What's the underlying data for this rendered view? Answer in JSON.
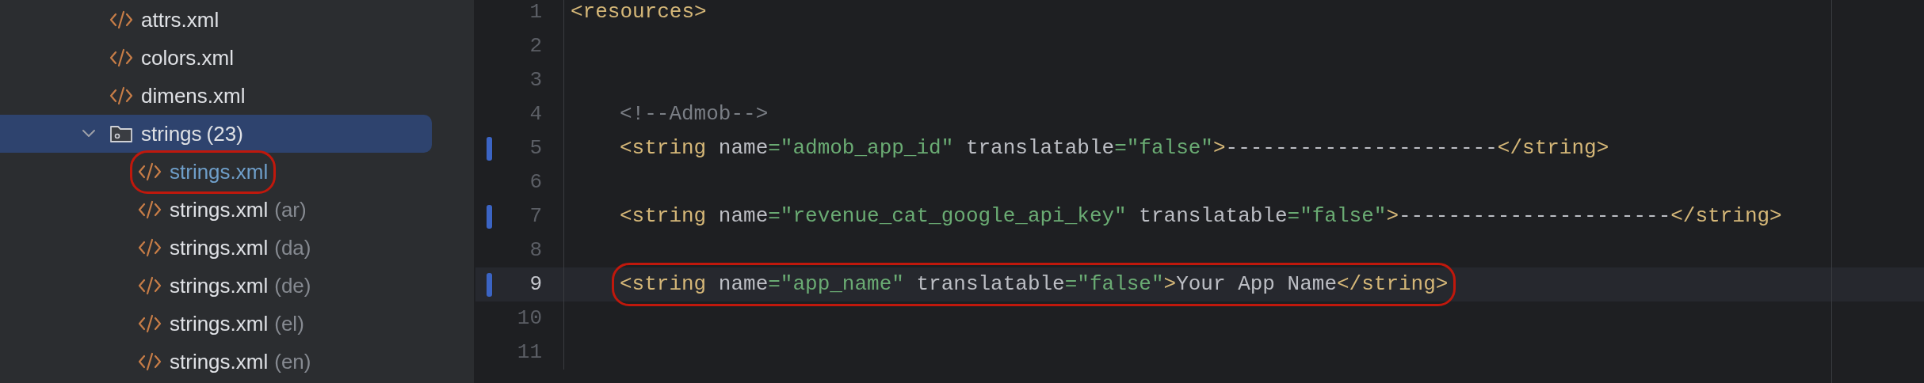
{
  "project_tree": {
    "items": [
      {
        "kind": "file",
        "name": "attrs.xml",
        "selected": false
      },
      {
        "kind": "file",
        "name": "colors.xml",
        "selected": false
      },
      {
        "kind": "file",
        "name": "dimens.xml",
        "selected": false
      },
      {
        "kind": "folder",
        "name": "strings",
        "count": "(23)",
        "expanded": true,
        "selected": true,
        "children": [
          {
            "kind": "file",
            "name": "strings.xml",
            "open": true,
            "circled": true
          },
          {
            "kind": "file",
            "name": "strings.xml",
            "qualifier": "(ar)",
            "open": false,
            "circled": false
          },
          {
            "kind": "file",
            "name": "strings.xml",
            "qualifier": "(da)",
            "open": false,
            "circled": false
          },
          {
            "kind": "file",
            "name": "strings.xml",
            "qualifier": "(de)",
            "open": false,
            "circled": false
          },
          {
            "kind": "file",
            "name": "strings.xml",
            "qualifier": "(el)",
            "open": false,
            "circled": false
          },
          {
            "kind": "file",
            "name": "strings.xml",
            "qualifier": "(en)",
            "open": false,
            "circled": false
          }
        ]
      }
    ]
  },
  "editor": {
    "lines": [
      {
        "number": "1",
        "changed": false,
        "current": false,
        "indented": false,
        "tokens": [
          {
            "kind": "tag",
            "text": "<resources>"
          }
        ]
      },
      {
        "number": "2",
        "changed": false,
        "current": false
      },
      {
        "number": "3",
        "changed": false,
        "current": false
      },
      {
        "number": "4",
        "changed": false,
        "current": false,
        "indented": true,
        "tokens": [
          {
            "kind": "comment",
            "text": "<!--Admob-->"
          }
        ]
      },
      {
        "number": "5",
        "changed": true,
        "current": false,
        "indented": true,
        "tokens": [
          {
            "kind": "tag",
            "text": "<string"
          },
          {
            "kind": "plain",
            "text": " name"
          },
          {
            "kind": "value",
            "text": "=\"admob_app_id\""
          },
          {
            "kind": "plain",
            "text": " translatable"
          },
          {
            "kind": "value",
            "text": "=\"false\""
          },
          {
            "kind": "tag",
            "text": ">"
          },
          {
            "kind": "plain",
            "text": "----------------------"
          },
          {
            "kind": "tag",
            "text": "</string>"
          }
        ]
      },
      {
        "number": "6",
        "changed": false,
        "current": false
      },
      {
        "number": "7",
        "changed": true,
        "current": false,
        "indented": true,
        "tokens": [
          {
            "kind": "tag",
            "text": "<string"
          },
          {
            "kind": "plain",
            "text": " name"
          },
          {
            "kind": "value",
            "text": "=\"revenue_cat_google_api_key\""
          },
          {
            "kind": "plain",
            "text": " translatable"
          },
          {
            "kind": "value",
            "text": "=\"false\""
          },
          {
            "kind": "tag",
            "text": ">"
          },
          {
            "kind": "plain",
            "text": "----------------------"
          },
          {
            "kind": "tag",
            "text": "</string>"
          }
        ]
      },
      {
        "number": "8",
        "changed": false,
        "current": false
      },
      {
        "number": "9",
        "changed": true,
        "current": true,
        "circled": true,
        "indented": true,
        "tokens": [
          {
            "kind": "tag",
            "text": "<string"
          },
          {
            "kind": "plain",
            "text": " name"
          },
          {
            "kind": "value",
            "text": "=\"app_name\""
          },
          {
            "kind": "plain",
            "text": " translatable"
          },
          {
            "kind": "value",
            "text": "=\"false\""
          },
          {
            "kind": "tag",
            "text": ">"
          },
          {
            "kind": "plain",
            "text": "Your App Name"
          },
          {
            "kind": "tag",
            "text": "</string>"
          }
        ]
      },
      {
        "number": "10",
        "changed": false,
        "current": false
      },
      {
        "number": "11",
        "changed": false,
        "current": false
      }
    ]
  }
}
